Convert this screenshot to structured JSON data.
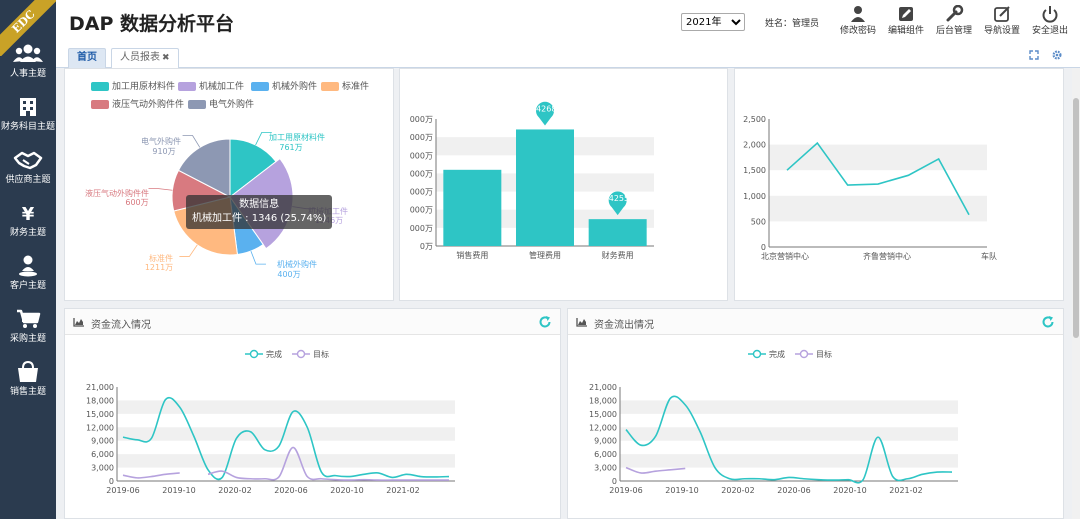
{
  "sidebar": {
    "logo_text": "EDC",
    "items": [
      {
        "label": "人事主题",
        "icon": "users-icon"
      },
      {
        "label": "财务科目主题",
        "icon": "building-icon"
      },
      {
        "label": "供应商主题",
        "icon": "handshake-icon"
      },
      {
        "label": "财务主题",
        "icon": "yen-icon"
      },
      {
        "label": "客户主题",
        "icon": "person-icon"
      },
      {
        "label": "采购主题",
        "icon": "cart-icon"
      },
      {
        "label": "销售主题",
        "icon": "bag-icon"
      }
    ]
  },
  "header": {
    "title": "DAP 数据分析平台",
    "year": "2021年",
    "user": "姓名：管理员",
    "tools": [
      {
        "label": "修改密码",
        "icon": "user-icon"
      },
      {
        "label": "编辑组件",
        "icon": "edit-icon"
      },
      {
        "label": "后台管理",
        "icon": "wrench-icon"
      },
      {
        "label": "导航设置",
        "icon": "pen-square-icon"
      },
      {
        "label": "安全退出",
        "icon": "power-icon"
      }
    ]
  },
  "tabs": [
    {
      "label": "首页",
      "active": true
    },
    {
      "label": "人员报表",
      "close": "✖",
      "active": false
    }
  ],
  "pie": {
    "legend": [
      "加工用原材料件",
      "机械加工件",
      "机械外购件",
      "标准件",
      "液压气动外购件件",
      "电气外购件"
    ],
    "labels": [
      {
        "name": "加工用原材料件",
        "value": "761万"
      },
      {
        "name": "机械加工件",
        "value": "1346万"
      },
      {
        "name": "机械外购件",
        "value": "400万"
      },
      {
        "name": "标准件",
        "value": "1211万"
      },
      {
        "name": "液压气动外购件件",
        "value": "600万"
      },
      {
        "name": "电气外购件",
        "value": "910万"
      }
    ],
    "colors": [
      "#2ec5c5",
      "#b6a2de",
      "#5ab1ef",
      "#ffb980",
      "#d87a80",
      "#8d98b3"
    ],
    "tooltip_title": "数据信息",
    "tooltip_body": "机械加工件 : 1346 (25.74%)"
  },
  "chart_data": [
    {
      "type": "pie",
      "title": "",
      "labels": [
        "加工用原材料件",
        "机械加工件",
        "机械外购件",
        "标准件",
        "液压气动外购件件",
        "电气外购件"
      ],
      "values": [
        761,
        1346,
        400,
        1211,
        600,
        910
      ],
      "unit": "万"
    },
    {
      "type": "bar",
      "title": "",
      "categories": [
        "销售费用",
        "管理费用",
        "财务费用"
      ],
      "values": [
        4200,
        6424,
        1480
      ],
      "markers": [
        "",
        "6424268.00",
        "1484255.84"
      ],
      "y_tick_labels": [
        "0万",
        "000万",
        "000万",
        "000万",
        "000万",
        "000万",
        "000万",
        "000万"
      ],
      "ylim": [
        0,
        7000
      ]
    },
    {
      "type": "line",
      "title": "",
      "x": [
        "北京营销中心",
        "",
        "齐鲁营销中心",
        "",
        "车队"
      ],
      "values": [
        1500,
        2030,
        1210,
        1230,
        1400,
        1720,
        630
      ],
      "ylim": [
        0,
        2500
      ],
      "y_ticks": [
        "0",
        "500",
        "1,000",
        "1,500",
        "2,000",
        "2,500"
      ]
    },
    {
      "type": "line",
      "title": "资金流入情况",
      "legend": [
        "完成",
        "目标"
      ],
      "x_labels": [
        "2019-06",
        "2019-10",
        "2020-02",
        "2020-06",
        "2020-10",
        "2021-02"
      ],
      "y_ticks": [
        "0",
        "3,000",
        "6,000",
        "9,000",
        "12,000",
        "15,000",
        "18,000",
        "21,000"
      ],
      "ylim": [
        0,
        21000
      ],
      "series": [
        {
          "name": "完成",
          "color": "#2ec5c5",
          "values": [
            9800,
            9200,
            9500,
            18200,
            16500,
            10000,
            2500,
            800,
            9500,
            11000,
            7000,
            7800,
            15500,
            12000,
            2000,
            1200,
            1000,
            1500,
            1800,
            800,
            1500,
            1000,
            900,
            1000
          ]
        },
        {
          "name": "目标",
          "color": "#b6a2de",
          "values": [
            1300,
            700,
            1000,
            1500,
            1800,
            null,
            1500,
            2200,
            800,
            500,
            500,
            900,
            7500,
            1000,
            500,
            300,
            200,
            300,
            200,
            200,
            200,
            200,
            200,
            200
          ]
        }
      ]
    },
    {
      "type": "line",
      "title": "资金流出情况",
      "legend": [
        "完成",
        "目标"
      ],
      "x_labels": [
        "2019-06",
        "2019-10",
        "2020-02",
        "2020-06",
        "2020-10",
        "2021-02"
      ],
      "y_ticks": [
        "0",
        "3,000",
        "6,000",
        "9,000",
        "12,000",
        "15,000",
        "18,000",
        "21,000"
      ],
      "ylim": [
        0,
        21000
      ],
      "series": [
        {
          "name": "完成",
          "color": "#2ec5c5",
          "values": [
            11500,
            8000,
            10000,
            18500,
            17000,
            11000,
            3000,
            500,
            500,
            500,
            300,
            800,
            500,
            300,
            200,
            300,
            300,
            9800,
            1000,
            500,
            1500,
            2000,
            2000
          ]
        },
        {
          "name": "目标",
          "color": "#b6a2de",
          "values": [
            3000,
            1800,
            2200,
            2500,
            2800,
            null,
            null,
            null,
            null,
            null,
            null,
            null,
            null,
            null,
            null,
            null,
            null,
            null,
            null,
            null,
            null,
            null,
            null
          ]
        }
      ]
    }
  ]
}
